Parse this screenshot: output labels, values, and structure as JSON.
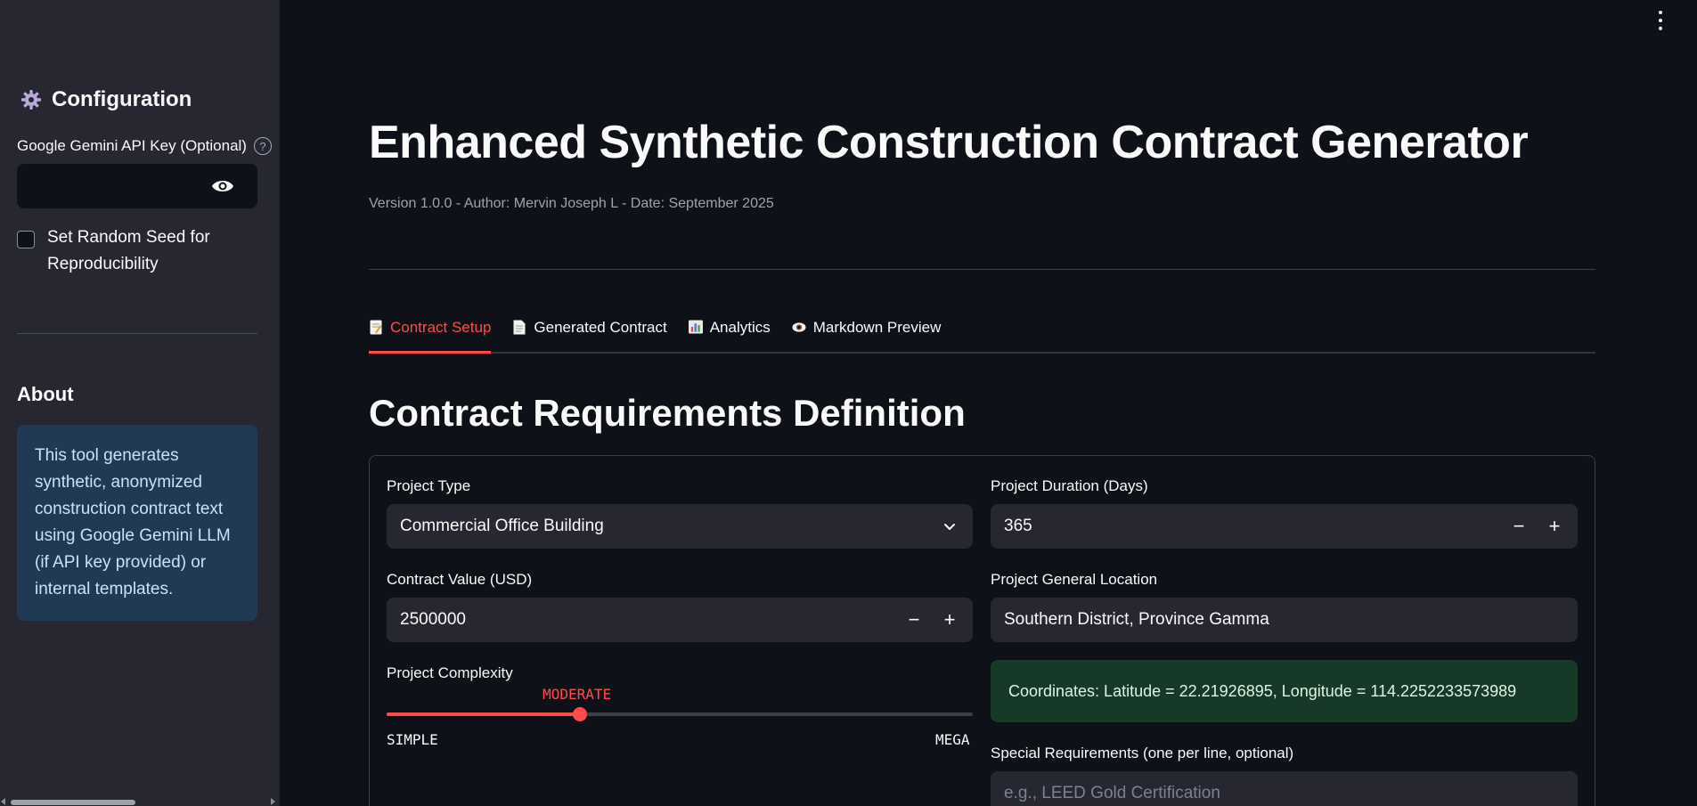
{
  "sidebar": {
    "header": "Configuration",
    "api_key_label": "Google Gemini API Key (Optional)",
    "api_key_value": "",
    "seed_label": "Set Random Seed for Reproducibility",
    "about_title": "About",
    "about_text": "This tool generates synthetic, anonymized construction contract text using Google Gemini LLM (if API key provided) or internal templates."
  },
  "main": {
    "title": "Enhanced Synthetic Construction Contract Generator",
    "version": "Version 1.0.0 - Author: Mervin Joseph L - Date: September 2025",
    "tabs": [
      {
        "label": "Contract Setup",
        "icon": "memo-icon"
      },
      {
        "label": "Generated Contract",
        "icon": "page-icon"
      },
      {
        "label": "Analytics",
        "icon": "bar-chart-icon"
      },
      {
        "label": "Markdown Preview",
        "icon": "eye-icon"
      }
    ],
    "section_title": "Contract Requirements Definition"
  },
  "form": {
    "project_type": {
      "label": "Project Type",
      "value": "Commercial Office Building"
    },
    "duration": {
      "label": "Project Duration (Days)",
      "value": "365"
    },
    "contract_value": {
      "label": "Contract Value (USD)",
      "value": "2500000"
    },
    "location": {
      "label": "Project General Location",
      "value": "Southern District, Province Gamma"
    },
    "complexity": {
      "label": "Project Complexity",
      "value": "MODERATE",
      "min": "SIMPLE",
      "max": "MEGA",
      "fraction": 0.33
    },
    "coordinates": "Coordinates: Latitude = 22.21926895, Longitude = 114.2252233573989",
    "special": {
      "label": "Special Requirements (one per line, optional)",
      "placeholder": "e.g., LEED Gold Certification"
    }
  },
  "colors": {
    "accent": "#ff4b4b",
    "sidebar_bg": "#262730",
    "page_bg": "#0e1117",
    "info_bg": "#1f3a52",
    "success_bg": "#173928"
  }
}
